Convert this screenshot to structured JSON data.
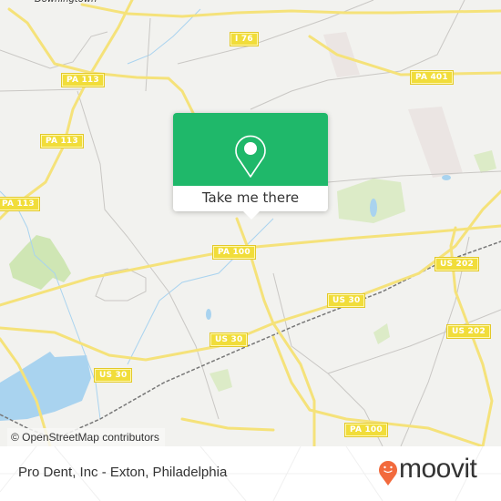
{
  "map": {
    "place_labels": [
      {
        "id": "downingtown",
        "text": "Downingtown"
      }
    ],
    "road_shields": [
      {
        "id": "pa113-a",
        "text": "PA 113"
      },
      {
        "id": "pa113-b",
        "text": "PA 113"
      },
      {
        "id": "pa113-c",
        "text": "PA 113"
      },
      {
        "id": "i76",
        "text": "I 76"
      },
      {
        "id": "pa401",
        "text": "PA 401"
      },
      {
        "id": "pa100-a",
        "text": "PA 100"
      },
      {
        "id": "us30-a",
        "text": "US 30"
      },
      {
        "id": "us30-b",
        "text": "US 30"
      },
      {
        "id": "us30-c",
        "text": "US 30"
      },
      {
        "id": "us202-a",
        "text": "US 202"
      },
      {
        "id": "us202-b",
        "text": "US 202"
      },
      {
        "id": "pa100-b",
        "text": "PA 100"
      }
    ],
    "attribution": "© OpenStreetMap contributors",
    "colors": {
      "background": "#f2f2ef",
      "road": "#f5e27a",
      "water": "#a9d3ef",
      "park": "#cfe6b4",
      "rail": "#777777"
    }
  },
  "popup": {
    "icon": "map-pin-icon",
    "button_label": "Take me there",
    "color": "#1fb86a"
  },
  "footer": {
    "title": "Pro Dent, Inc - Exton, Philadelphia",
    "logo_text": "moovit",
    "logo_color": "#f26a3d"
  }
}
